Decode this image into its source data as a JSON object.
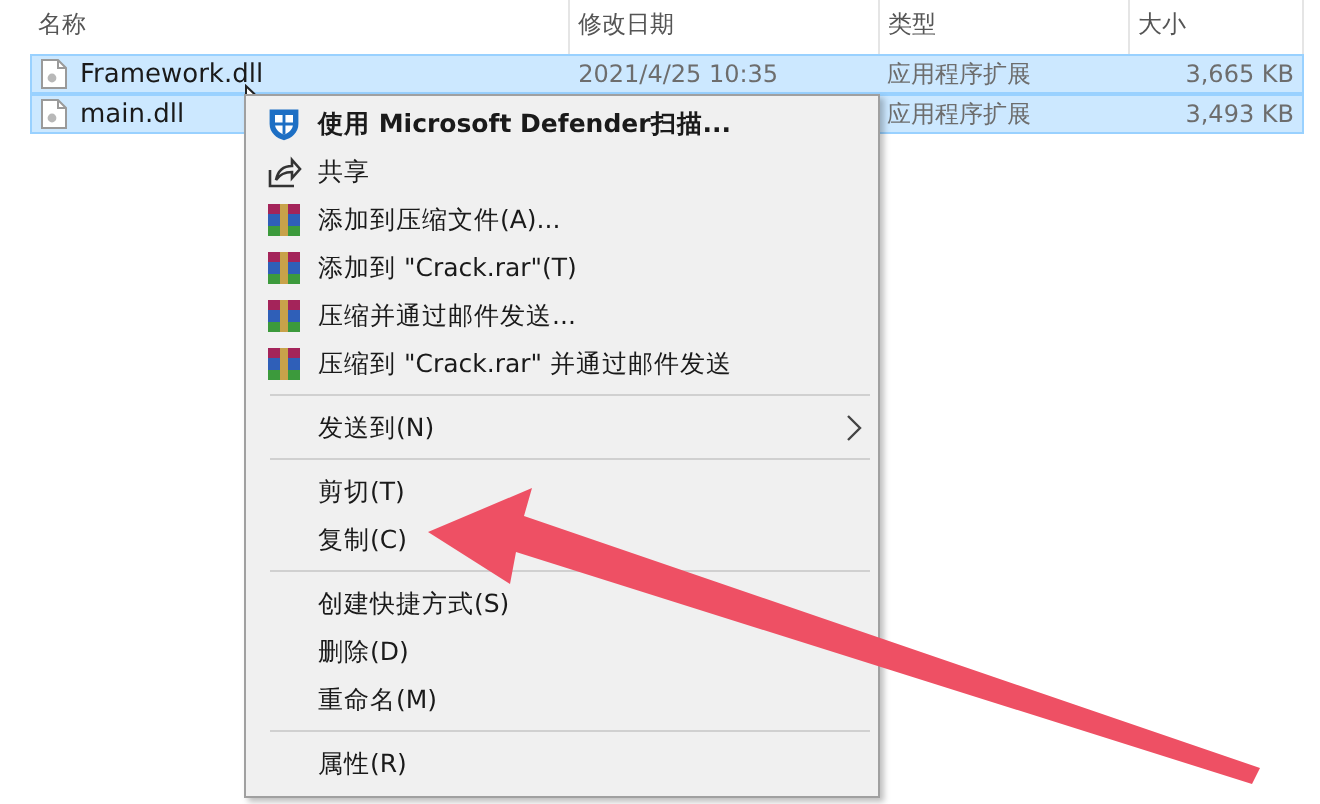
{
  "columns": [
    "名称",
    "修改日期",
    "类型",
    "大小"
  ],
  "files": [
    {
      "name": "Framework.dll",
      "date": "2021/4/25 10:35",
      "type": "应用程序扩展",
      "size": "3,665 KB",
      "selected": true
    },
    {
      "name": "main.dll",
      "type": "应用程序扩展",
      "size": "3,493 KB",
      "selected": true
    }
  ],
  "context_menu": [
    {
      "kind": "defender",
      "label": "使用 Microsoft Defender扫描...",
      "submenu": false
    },
    {
      "kind": "share",
      "label": "共享",
      "submenu": false
    },
    {
      "kind": "archive",
      "label": "添加到压缩文件(A)...",
      "submenu": false
    },
    {
      "kind": "archive",
      "label": "添加到 \"Crack.rar\"(T)",
      "submenu": false
    },
    {
      "kind": "archive",
      "label": "压缩并通过邮件发送...",
      "submenu": false
    },
    {
      "kind": "archive",
      "label": "压缩到 \"Crack.rar\" 并通过邮件发送",
      "submenu": false
    },
    {
      "kind": "separator"
    },
    {
      "kind": "plain",
      "label": "发送到(N)",
      "submenu": true
    },
    {
      "kind": "separator"
    },
    {
      "kind": "plain",
      "label": "剪切(T)",
      "submenu": false
    },
    {
      "kind": "plain",
      "label": "复制(C)",
      "submenu": false
    },
    {
      "kind": "separator"
    },
    {
      "kind": "plain",
      "label": "创建快捷方式(S)",
      "submenu": false
    },
    {
      "kind": "plain",
      "label": "删除(D)",
      "submenu": false
    },
    {
      "kind": "plain",
      "label": "重命名(M)",
      "submenu": false
    },
    {
      "kind": "separator"
    },
    {
      "kind": "plain",
      "label": "属性(R)",
      "submenu": false
    }
  ]
}
